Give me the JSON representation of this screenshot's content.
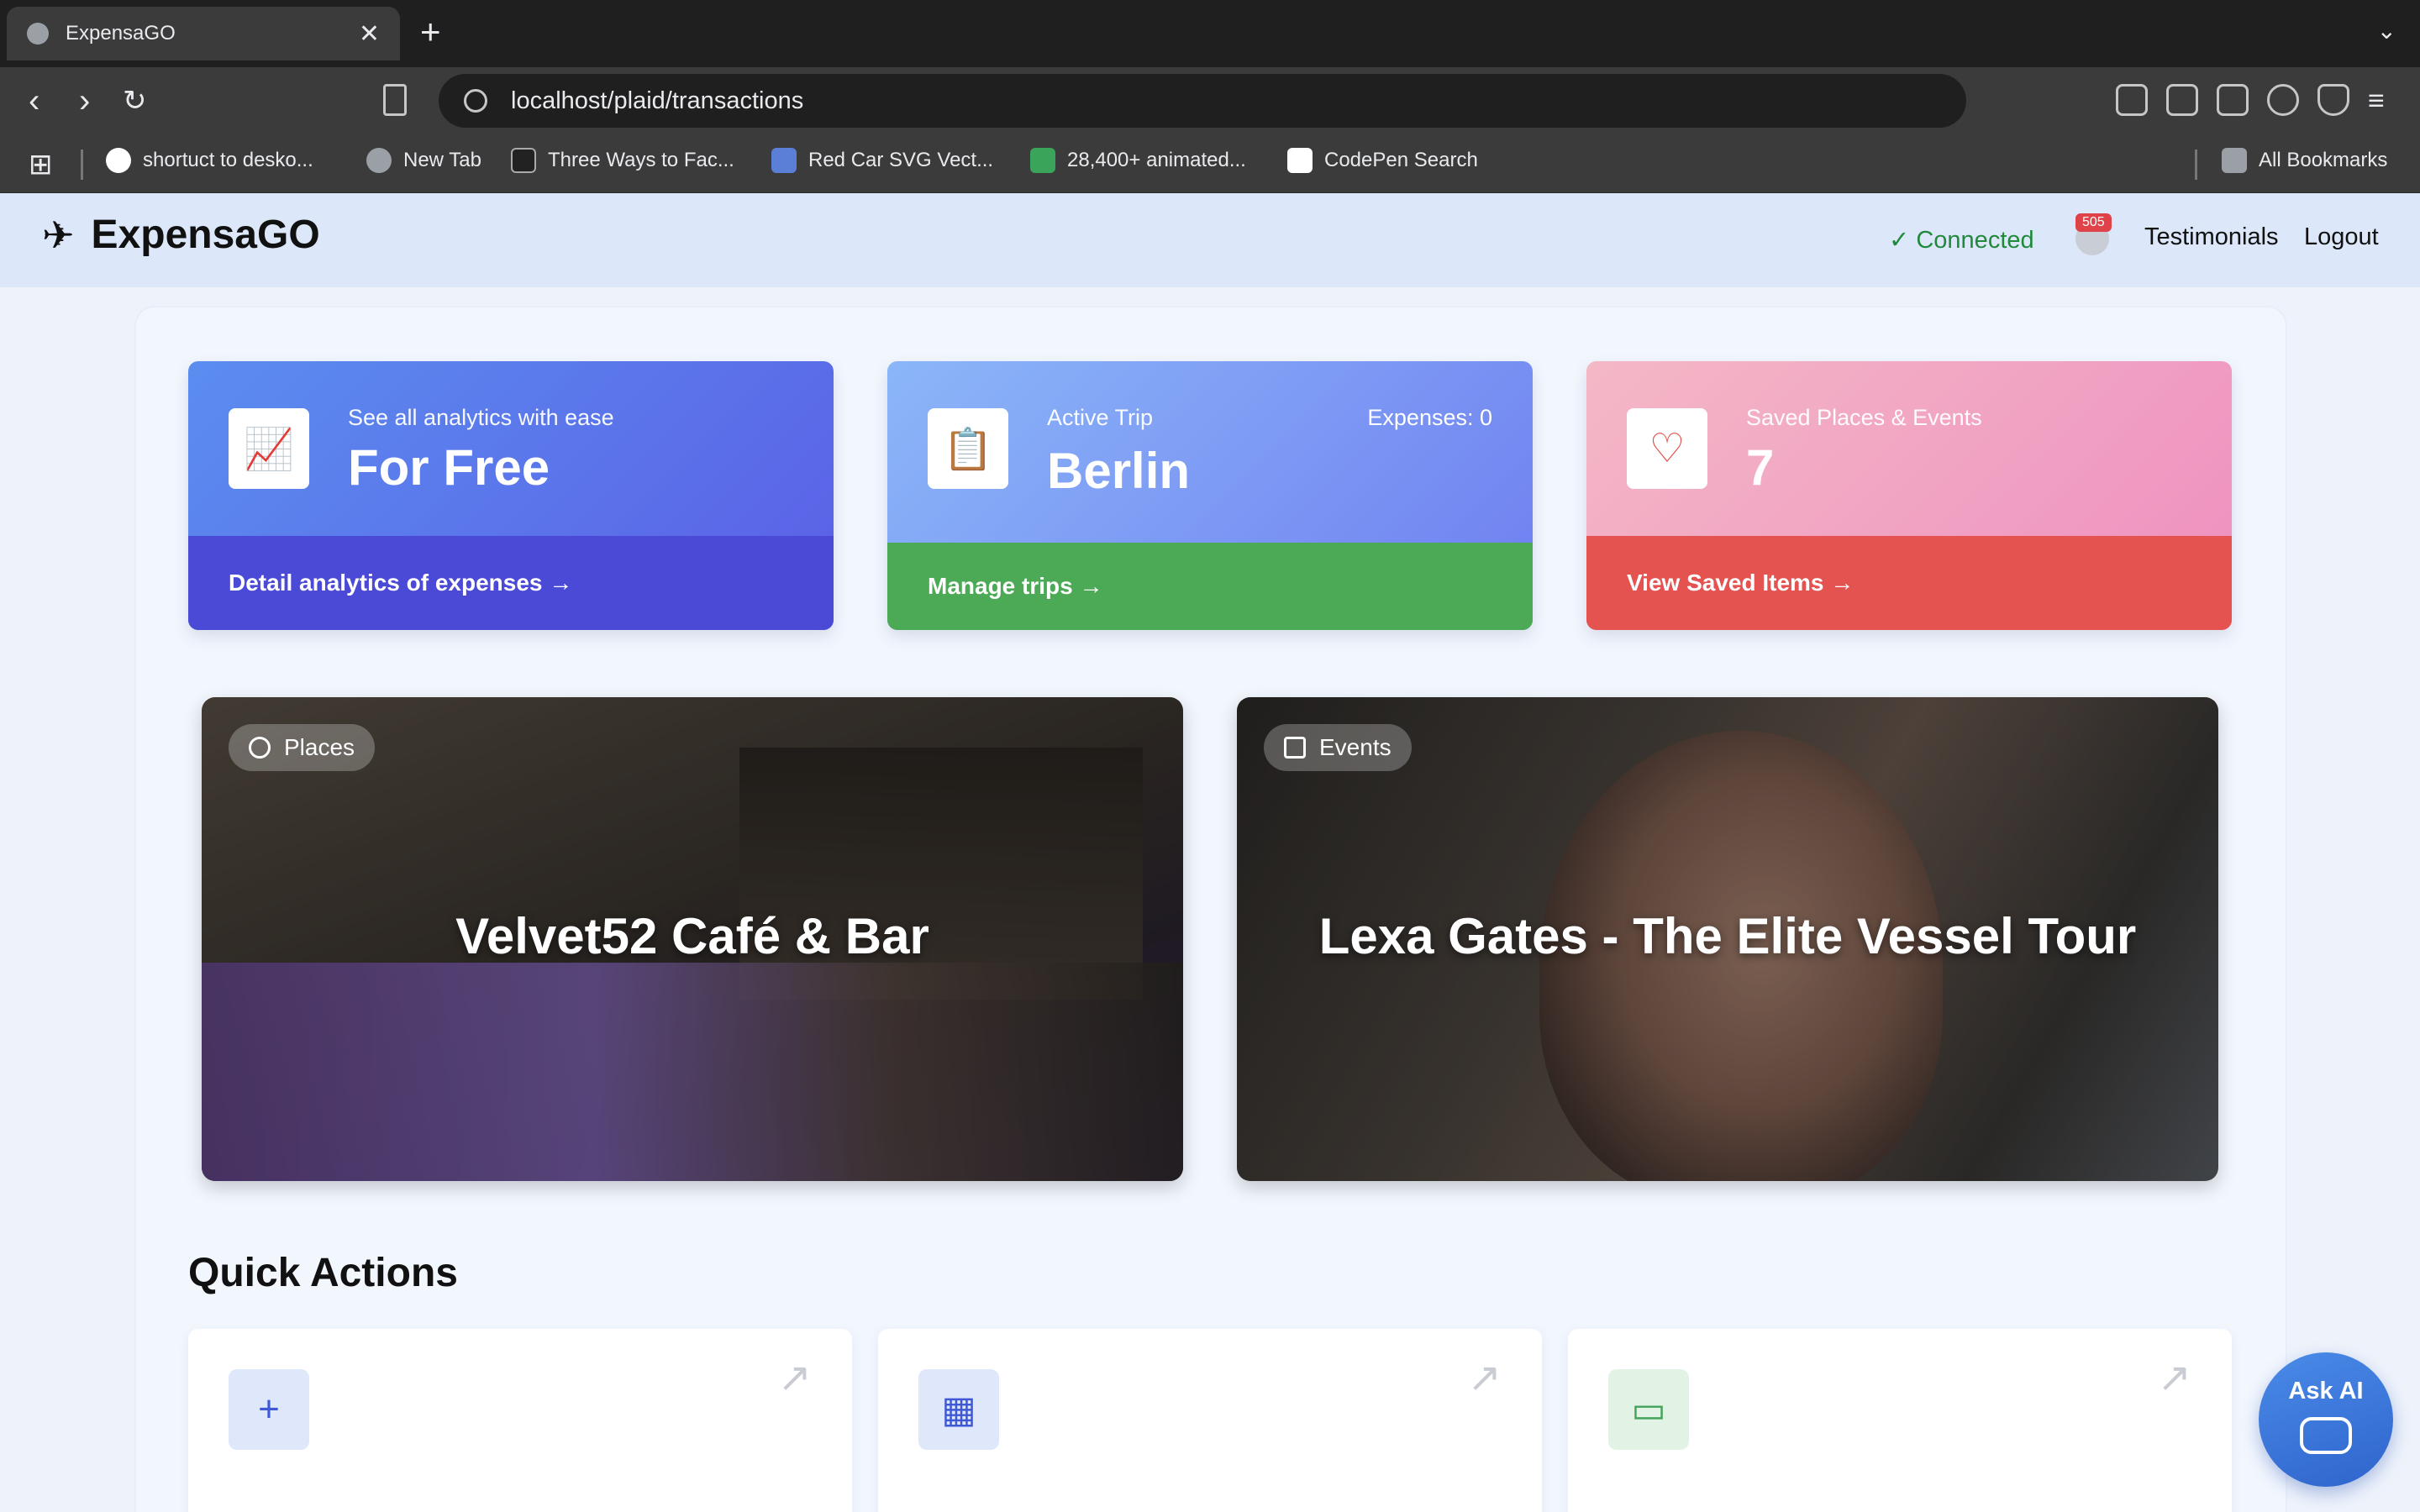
{
  "browser": {
    "tab_title": "ExpensaGO",
    "tab_close": "✕",
    "new_tab": "+",
    "tab_menu": "⌄",
    "back": "‹",
    "forward": "›",
    "reload": "↻",
    "url": "localhost/plaid/transactions",
    "bookmarks": [
      {
        "label": "shortuct to desko...",
        "color": "#ffffff"
      },
      {
        "label": "New Tab",
        "color": "#9aa0a6"
      },
      {
        "label": "Three Ways to Fac...",
        "color": "#222222"
      },
      {
        "label": "Red Car SVG Vect...",
        "color": "#5b7fd6"
      },
      {
        "label": "28,400+ animated...",
        "color": "#3aa55a"
      },
      {
        "label": "CodePen Search",
        "color": "#ffffff"
      }
    ],
    "all_bookmarks": "All Bookmarks"
  },
  "header": {
    "logo_icon": "✈",
    "brand": "ExpensaGO",
    "status": "✓ Connected",
    "notifications": "505",
    "links": {
      "testimonials": "Testimonials",
      "logout": "Logout"
    }
  },
  "stats": [
    {
      "icon": "chart-icon",
      "glyph": "📈",
      "label": "See all analytics with ease",
      "value": "For Free",
      "action": "Detail analytics of expenses →"
    },
    {
      "icon": "clipboard-icon",
      "glyph": "📋",
      "label": "Active Trip",
      "value": "Berlin",
      "extra": "Expenses: 0",
      "action": "Manage trips →"
    },
    {
      "icon": "heart-icon",
      "glyph": "♡",
      "label": "Saved Places & Events",
      "value": "7",
      "action": "View Saved Items →"
    }
  ],
  "features": [
    {
      "badge": "Places",
      "title": "Velvet52 Café & Bar"
    },
    {
      "badge": "Events",
      "title": "Lexa Gates - The Elite Vessel Tour"
    }
  ],
  "quick_actions": {
    "title": "Quick Actions",
    "items": [
      {
        "icon": "plus-icon",
        "glyph": "+",
        "arrow": "↗"
      },
      {
        "icon": "calendar-icon",
        "glyph": "▦",
        "arrow": "↗"
      },
      {
        "icon": "card-icon",
        "glyph": "▭",
        "arrow": "↗"
      }
    ]
  },
  "ask_ai": "Ask AI",
  "colors": {
    "primary": "#4b4ad6",
    "success": "#4caa56",
    "danger": "#e4534f",
    "connected": "#1f8a3a"
  }
}
